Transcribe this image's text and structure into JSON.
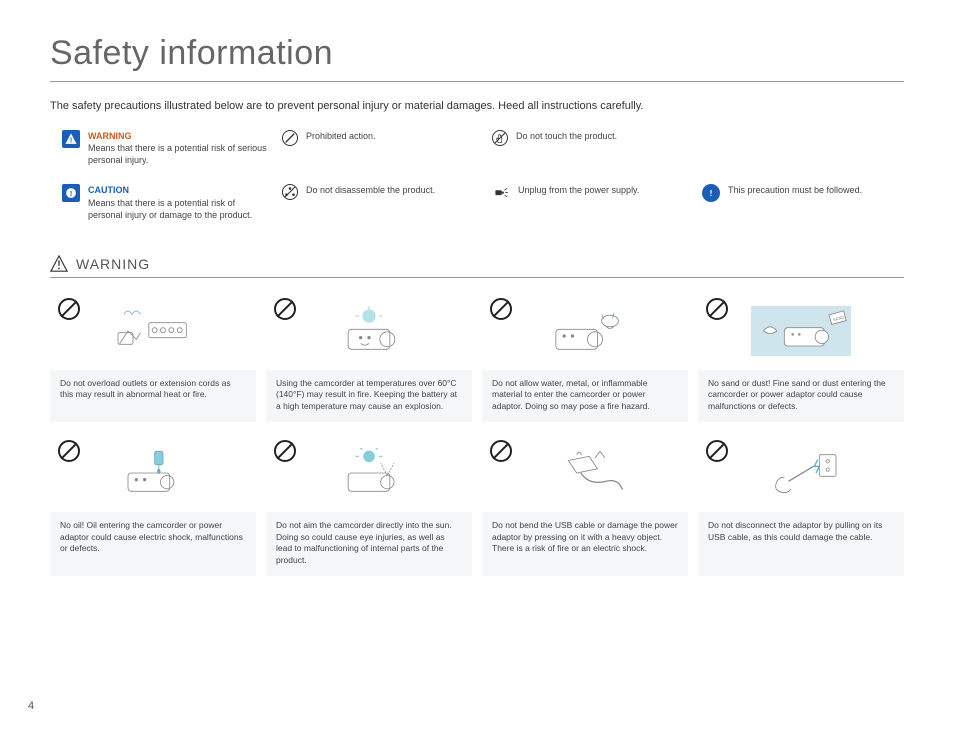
{
  "page": {
    "title": "Safety information",
    "intro": "The safety precautions illustrated below are to prevent personal injury or material damages. Heed all instructions carefully.",
    "page_number": "4"
  },
  "legend": {
    "warning_title": "WARNING",
    "warning_desc": "Means that there is a potential risk of serious personal injury.",
    "caution_title": "CAUTION",
    "caution_desc": "Means that there is a potential risk of personal injury or damage to the product.",
    "prohibited": "Prohibited action.",
    "disassemble": "Do not disassemble the product.",
    "no_touch": "Do not touch the product.",
    "unplug": "Unplug from the power supply.",
    "must_follow": "This precaution must be followed."
  },
  "section": {
    "warning_label": "WARNING"
  },
  "cards": [
    "Do not overload outlets or extension cords as this may result in abnormal heat or fire.",
    "Using the camcorder at temperatures over 60°C (140°F) may result in fire. Keeping the battery at a high temperature may cause an explosion.",
    "Do not allow water, metal, or inflammable material to enter the camcorder or power adaptor. Doing so may pose a fire hazard.",
    "No sand or dust! Fine sand or dust entering the camcorder or power adaptor could cause malfunctions or defects.",
    "No oil! Oil entering the camcorder or power adaptor could cause electric shock, malfunctions or defects.",
    "Do not aim the camcorder directly into the sun. Doing so could cause eye injuries, as well as lead to malfunctioning of internal parts of the product.",
    "Do not bend the USB cable or damage the power adaptor by pressing on it with a heavy object. There is a risk of fire or an electric shock.",
    "Do not disconnect the adaptor by pulling on its USB cable, as this could damage the cable."
  ]
}
